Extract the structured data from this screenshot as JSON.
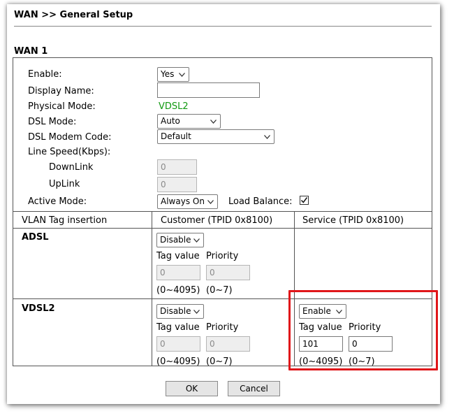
{
  "page": {
    "title": "WAN >> General Setup",
    "section": "WAN 1"
  },
  "wan": {
    "enable_label": "Enable:",
    "enable_value": "Yes",
    "display_name_label": "Display Name:",
    "display_name_value": "",
    "physical_mode_label": "Physical Mode:",
    "physical_mode_value": "VDSL2",
    "dsl_mode_label": "DSL Mode:",
    "dsl_mode_value": "Auto",
    "dsl_modem_code_label": "DSL Modem Code:",
    "dsl_modem_code_value": "Default",
    "line_speed_label": "Line Speed(Kbps):",
    "downlink_label": "DownLink",
    "downlink_value": "0",
    "uplink_label": "UpLink",
    "uplink_value": "0",
    "active_mode_label": "Active Mode:",
    "active_mode_value": "Always On",
    "load_balance_label": "Load Balance:",
    "load_balance_checked": true
  },
  "vlan": {
    "header_label": "VLAN Tag insertion",
    "customer_header": "Customer (TPID 0x8100)",
    "service_header": "Service (TPID 0x8100)",
    "adsl": {
      "label": "ADSL",
      "customer": {
        "mode": "Disable",
        "tag_label": "Tag value",
        "priority_label": "Priority",
        "tag_value": "0",
        "priority_value": "0",
        "tag_range": "(0~4095)",
        "priority_range": "(0~7)"
      }
    },
    "vdsl2": {
      "label": "VDSL2",
      "customer": {
        "mode": "Disable",
        "tag_label": "Tag value",
        "priority_label": "Priority",
        "tag_value": "0",
        "priority_value": "0",
        "tag_range": "(0~4095)",
        "priority_range": "(0~7)"
      },
      "service": {
        "mode": "Enable",
        "tag_label": "Tag value",
        "priority_label": "Priority",
        "tag_value": "101",
        "priority_value": "0",
        "tag_range": "(0~4095)",
        "priority_range": "(0~7)"
      }
    }
  },
  "buttons": {
    "ok": "OK",
    "cancel": "Cancel"
  },
  "colors": {
    "highlight": "#e0161a",
    "physical_mode": "#119911"
  }
}
